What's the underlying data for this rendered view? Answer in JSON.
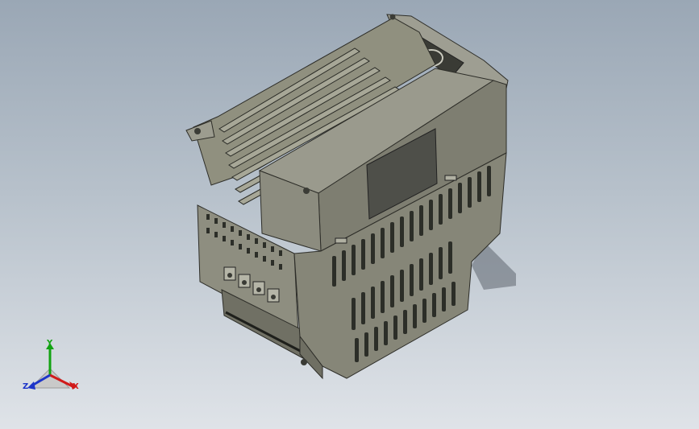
{
  "triad": {
    "x_label": "X",
    "y_label": "Y",
    "z_label": "Z",
    "x_color": "#d11a1a",
    "y_color": "#12a312",
    "z_color": "#1d35c9"
  },
  "model": {
    "body_color": "#8a8a7c",
    "shadow_color": "#55584f",
    "slot_color": "#2c2e28",
    "label_panel_color": "#4e4f49",
    "fin_color": "#a3a395"
  },
  "background": {
    "top_color": "#9aa7b5",
    "bottom_color": "#dfe3e8"
  }
}
